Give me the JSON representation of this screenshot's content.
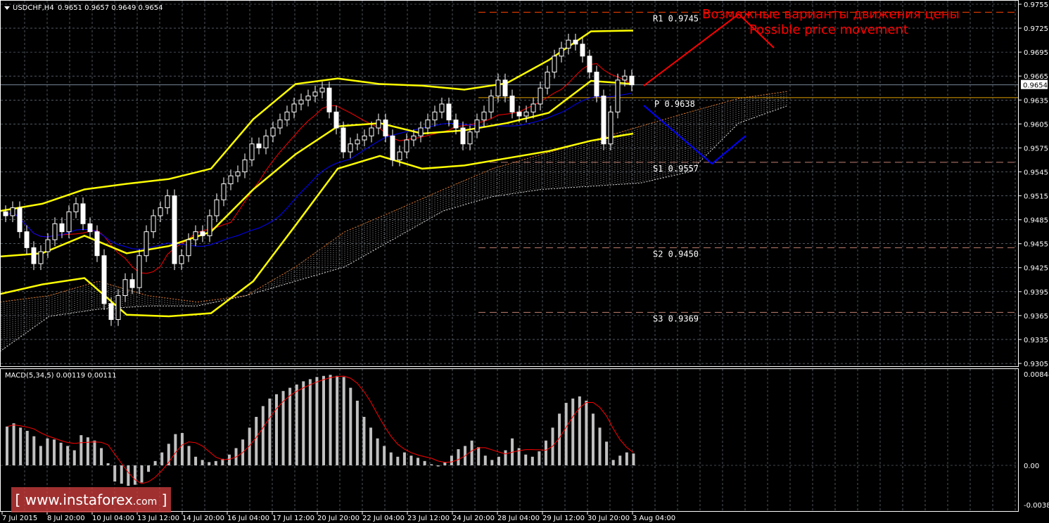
{
  "header": {
    "symbol": "USDCHF,H4",
    "ohlc": "0.9651 0.9657 0.9649 0.9654"
  },
  "macd_label": "MACD(5,34,5) 0.00119 0.00111",
  "annotation": {
    "ru": "Возможные варианты движения цены",
    "en": "Possible price movement"
  },
  "logo": {
    "text": "www.instaforex",
    "suffix": ".com",
    "left_bracket": "[",
    "right_bracket": "]"
  },
  "colors": {
    "background": "#000000",
    "bollinger": "#ffff00",
    "bull": "#ffffff",
    "bear": "#ffffff",
    "forecast_up": "#ff0000",
    "forecast_down": "#0000ff",
    "macd_hist": "#c0c0c0",
    "macd_signal": "#ff0000",
    "grid": "#7f8c9a"
  },
  "chart_data": [
    {
      "type": "candlestick",
      "title": "USDCHF,H4",
      "ylim": [
        0.929,
        0.976
      ],
      "y_ticks": [
        "0.9755",
        "0.9725",
        "0.9695",
        "0.9665",
        "0.9635",
        "0.9605",
        "0.9575",
        "0.9545",
        "0.9515",
        "0.9485",
        "0.9455",
        "0.9425",
        "0.9395",
        "0.9365",
        "0.9335",
        "0.9305"
      ],
      "current_price": "0.9654",
      "x_ticks": [
        "7 Jul 2015",
        "8 Jul 20:00",
        "10 Jul 04:00",
        "13 Jul 12:00",
        "14 Jul 20:00",
        "16 Jul 04:00",
        "17 Jul 12:00",
        "20 Jul 20:00",
        "22 Jul 04:00",
        "23 Jul 12:00",
        "24 Jul 20:00",
        "28 Jul 04:00",
        "29 Jul 12:00",
        "30 Jul 20:00",
        "3 Aug 04:00"
      ],
      "closes": [
        0.949,
        0.95,
        0.947,
        0.945,
        0.943,
        0.9445,
        0.946,
        0.948,
        0.947,
        0.9495,
        0.9505,
        0.948,
        0.947,
        0.944,
        0.938,
        0.936,
        0.939,
        0.941,
        0.94,
        0.944,
        0.947,
        0.949,
        0.95,
        0.9515,
        0.943,
        0.944,
        0.946,
        0.947,
        0.9465,
        0.949,
        0.951,
        0.953,
        0.954,
        0.9545,
        0.956,
        0.958,
        0.9575,
        0.959,
        0.96,
        0.961,
        0.962,
        0.963,
        0.9635,
        0.964,
        0.9645,
        0.965,
        0.962,
        0.96,
        0.957,
        0.958,
        0.9585,
        0.959,
        0.96,
        0.961,
        0.959,
        0.956,
        0.957,
        0.9585,
        0.959,
        0.96,
        0.961,
        0.962,
        0.963,
        0.961,
        0.96,
        0.958,
        0.9595,
        0.961,
        0.962,
        0.964,
        0.966,
        0.964,
        0.962,
        0.9615,
        0.962,
        0.963,
        0.965,
        0.967,
        0.969,
        0.97,
        0.971,
        0.9705,
        0.969,
        0.967,
        0.964,
        0.958,
        0.962,
        0.966,
        0.9665,
        0.9654
      ],
      "bollinger": {
        "upper": [
          0.9496,
          0.9505,
          0.9523,
          0.953,
          0.9536,
          0.9549,
          0.9611,
          0.9655,
          0.9662,
          0.9655,
          0.9653,
          0.9648,
          0.9656,
          0.9685,
          0.9721,
          0.9722
        ],
        "middle": [
          0.9439,
          0.9443,
          0.9465,
          0.9443,
          0.9452,
          0.947,
          0.9523,
          0.9567,
          0.9602,
          0.9606,
          0.9593,
          0.9597,
          0.9606,
          0.9619,
          0.9659,
          0.9655
        ],
        "lower": [
          0.9392,
          0.9404,
          0.9412,
          0.9366,
          0.9364,
          0.9368,
          0.9408,
          0.9478,
          0.9549,
          0.9565,
          0.9549,
          0.9553,
          0.9562,
          0.9571,
          0.9584,
          0.9593
        ]
      },
      "ichimoku_cloud": {
        "span_a": [
          0.9382,
          0.939,
          0.9408,
          0.939,
          0.9382,
          0.939,
          0.9426,
          0.947,
          0.9496,
          0.9523,
          0.9549,
          0.9567,
          0.9584,
          0.9602,
          0.962,
          0.9637,
          0.9646
        ],
        "span_b": [
          0.932,
          0.9364,
          0.9373,
          0.9377,
          0.9377,
          0.939,
          0.9408,
          0.9426,
          0.9461,
          0.9496,
          0.9514,
          0.9523,
          0.9527,
          0.9531,
          0.9545,
          0.9606,
          0.9628
        ]
      },
      "pivots": [
        {
          "label": "R1",
          "value": "0.9745",
          "color": "#ff4500"
        },
        {
          "label": "P",
          "value": "0.9638",
          "color": "#e0a000"
        },
        {
          "label": "S1",
          "value": "0.9557",
          "color": "#c08070"
        },
        {
          "label": "S2",
          "value": "0.9450",
          "color": "#c08070"
        },
        {
          "label": "S3",
          "value": "0.9369",
          "color": "#c08070"
        }
      ]
    },
    {
      "type": "bar",
      "title": "MACD(5,34,5) 0.00119 0.00111",
      "ylim": [
        -0.00384,
        0.00848
      ],
      "y_ticks": [
        "0.00848",
        "0.00",
        "-0.00384"
      ],
      "histogram": [
        0.0036,
        0.0039,
        0.0035,
        0.0032,
        0.0027,
        0.0018,
        0.0025,
        0.0024,
        0.0021,
        0.0018,
        0.0014,
        0.0028,
        0.0026,
        0.0023,
        0.0016,
        0.0002,
        -0.0015,
        -0.0017,
        -0.0019,
        -0.0018,
        -0.0016,
        -0.0006,
        0.0004,
        0.0012,
        0.002,
        0.0029,
        0.003,
        0.0018,
        0.0008,
        0.0005,
        0.0003,
        0.0004,
        0.0006,
        0.001,
        0.0016,
        0.0024,
        0.0035,
        0.0045,
        0.0055,
        0.0062,
        0.0066,
        0.0069,
        0.0072,
        0.0075,
        0.0078,
        0.008,
        0.0082,
        0.0083,
        0.0084,
        0.0083,
        0.0082,
        0.0072,
        0.006,
        0.0045,
        0.0035,
        0.0025,
        0.0018,
        0.0012,
        0.0008,
        0.0012,
        0.0009,
        0.0007,
        0.0004,
        0.0001,
        -0.0001,
        0.0003,
        0.0009,
        0.0015,
        0.0018,
        0.0023,
        0.0017,
        0.0009,
        0.0005,
        0.0008,
        0.0014,
        0.0025,
        0.0016,
        0.001,
        0.0008,
        0.0013,
        0.0023,
        0.0035,
        0.0048,
        0.0058,
        0.0062,
        0.0064,
        0.006,
        0.0048,
        0.0035,
        0.0022,
        0.0005,
        0.0009,
        0.0012,
        0.0011
      ]
    }
  ]
}
